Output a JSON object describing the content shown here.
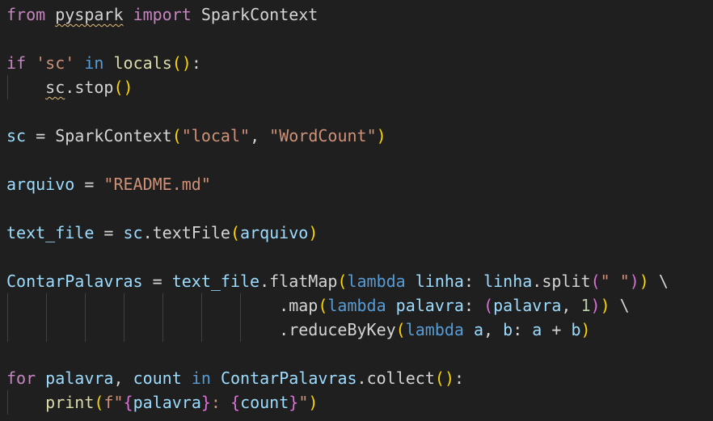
{
  "editor": {
    "tokens": {
      "l1": [
        "from",
        " ",
        "pyspark",
        " ",
        "import",
        " ",
        "SparkContext"
      ],
      "l3": [
        "if",
        " ",
        "'sc'",
        " ",
        "in",
        " ",
        "locals",
        "(",
        ")",
        ":"
      ],
      "l4": [
        "    ",
        "sc",
        ".",
        "stop",
        "(",
        ")"
      ],
      "l6": [
        "sc",
        " = ",
        "SparkContext",
        "(",
        "\"local\"",
        ", ",
        "\"WordCount\"",
        ")"
      ],
      "l8": [
        "arquivo",
        " = ",
        "\"README.md\""
      ],
      "l10": [
        "text_file",
        " = ",
        "sc",
        ".",
        "textFile",
        "(",
        "arquivo",
        ")"
      ],
      "l12": [
        "ContarPalavras",
        " = ",
        "text_file",
        ".",
        "flatMap",
        "(",
        "lambda",
        " ",
        "linha",
        ": ",
        "linha",
        ".",
        "split",
        "(",
        "\" \"",
        ")",
        ")",
        " \\"
      ],
      "l13": [
        "                            ",
        ".",
        "map",
        "(",
        "lambda",
        " ",
        "palavra",
        ": ",
        "(",
        "palavra",
        ", ",
        "1",
        ")",
        ")",
        " \\"
      ],
      "l14": [
        "                            ",
        ".",
        "reduceByKey",
        "(",
        "lambda",
        " ",
        "a",
        ", ",
        "b",
        ": ",
        "a",
        " + ",
        "b",
        ")"
      ],
      "l16": [
        "for",
        " ",
        "palavra",
        ", ",
        "count",
        " ",
        "in",
        " ",
        "ContarPalavras",
        ".",
        "collect",
        "(",
        ")",
        ":"
      ],
      "l17": [
        "    ",
        "print",
        "(",
        "f\"",
        "{",
        "palavra",
        "}",
        ": ",
        "{",
        "count",
        "}",
        "\"",
        ")"
      ]
    }
  }
}
